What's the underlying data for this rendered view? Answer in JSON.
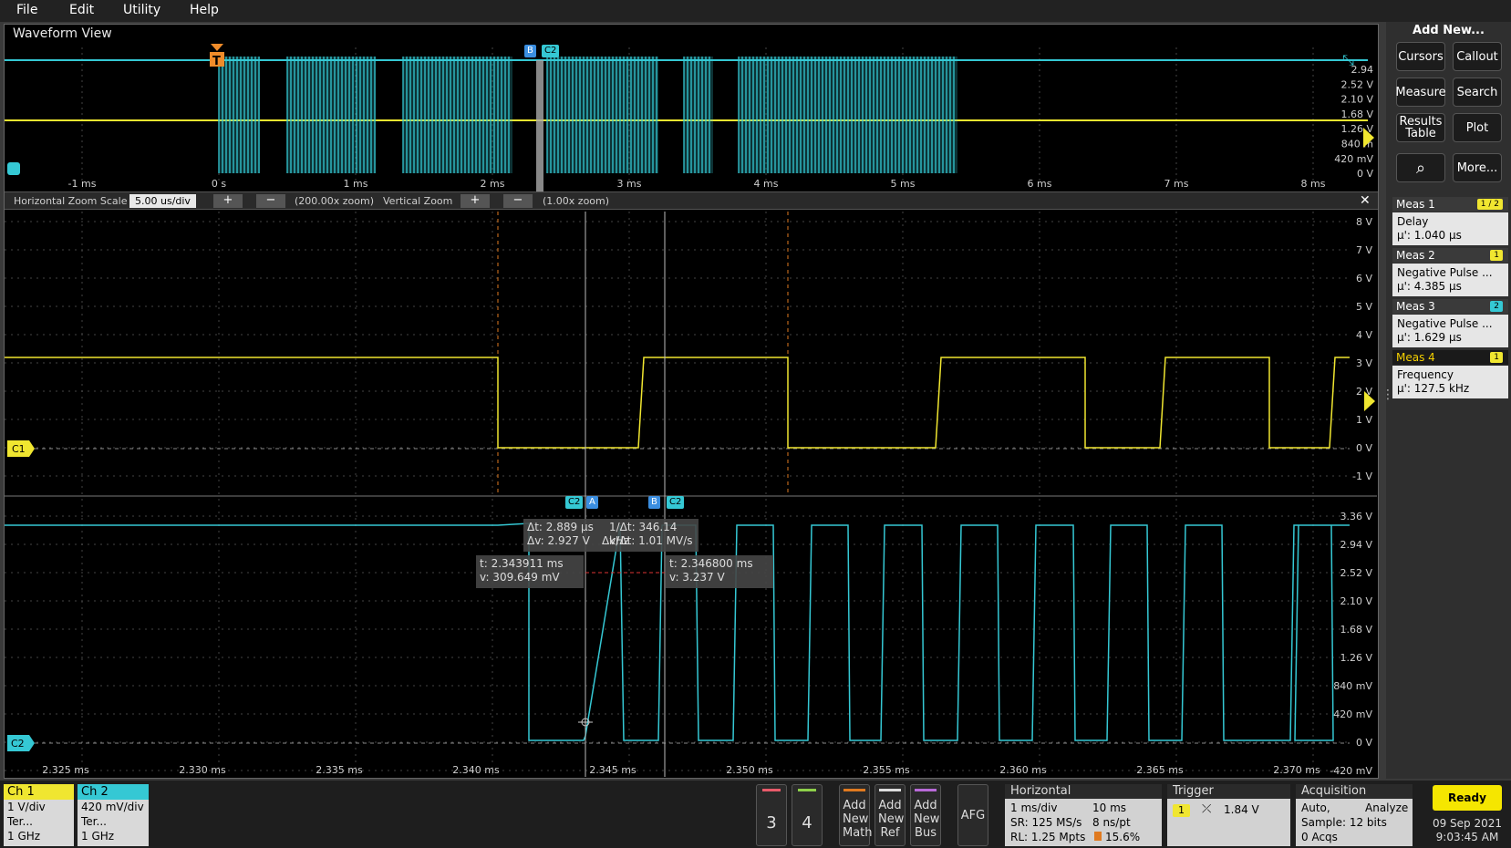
{
  "menu": {
    "file": "File",
    "edit": "Edit",
    "utility": "Utility",
    "help": "Help"
  },
  "waveform_view": {
    "title": "Waveform View"
  },
  "overview": {
    "x_ticks": [
      "-1 ms",
      "0 s",
      "1 ms",
      "2 ms",
      "3 ms",
      "4 ms",
      "5 ms",
      "6 ms",
      "7 ms",
      "8 ms"
    ],
    "y_ticks": [
      "2.94",
      "2.52 V",
      "2.10 V",
      "1.68 V",
      "1.26 V",
      "840 m",
      "420 mV",
      "0 V"
    ],
    "trigger_marker": "T",
    "tag_b": "B",
    "tag_c2": "C2"
  },
  "zoom_bar": {
    "h_label": "Horizontal Zoom Scale",
    "h_value": "5.00 us/div",
    "h_zoom": "(200.00x zoom)",
    "v_label": "Vertical Zoom",
    "v_zoom": "(1.00x zoom)",
    "plus": "+",
    "minus": "−",
    "close": "✕"
  },
  "ch1_plot": {
    "y_ticks": [
      "8 V",
      "7 V",
      "6 V",
      "5 V",
      "4 V",
      "3 V",
      "2 V",
      "1 V",
      "0 V",
      "-1 V"
    ],
    "label": "C1"
  },
  "ch2_plot": {
    "y_ticks": [
      "3.36 V",
      "2.94 V",
      "2.52 V",
      "2.10 V",
      "1.68 V",
      "1.26 V",
      "840 mV",
      "420 mV",
      "0 V",
      "-420 mV"
    ],
    "label": "C2",
    "x_ticks": [
      "2.325 ms",
      "2.330 ms",
      "2.335 ms",
      "2.340 ms",
      "2.345 ms",
      "2.350 ms",
      "2.355 ms",
      "2.360 ms",
      "2.365 ms",
      "2.370 ms"
    ]
  },
  "cursors": {
    "tag_c2_a": "C2",
    "tag_a": "A",
    "tag_b": "B",
    "tag_c2_b": "C2",
    "delta_t": "Δt: 2.889 µs",
    "delta_v": "Δv: 2.927 V",
    "inv_dt": "1/Δt: 346.14 kHz",
    "dv_dt": "Δv/Δt: 1.01 MV/s",
    "a_t": "t: 2.343911 ms",
    "a_v": "v: 309.649 mV",
    "b_t": "t: 2.346800 ms",
    "b_v": "v: 3.237 V"
  },
  "right_panel": {
    "add_new": "Add New...",
    "buttons": {
      "cursors": "Cursors",
      "callout": "Callout",
      "measure": "Measure",
      "search": "Search",
      "results_table": "Results Table",
      "plot": "Plot",
      "more": "More..."
    },
    "meas": [
      {
        "title": "Meas 1",
        "name": "Delay",
        "value": "µ': 1.040 µs",
        "badge": "1 / 2"
      },
      {
        "title": "Meas 2",
        "name": "Negative Pulse ...",
        "value": "µ': 4.385 µs",
        "badge": "1"
      },
      {
        "title": "Meas 3",
        "name": "Negative Pulse ...",
        "value": "µ': 1.629 µs",
        "badge": "2"
      },
      {
        "title": "Meas 4",
        "name": "Frequency",
        "value": "µ': 127.5 kHz",
        "badge": "1"
      }
    ]
  },
  "bottom": {
    "ch1": {
      "title": "Ch 1",
      "scale": "1 V/div",
      "term": "Ter...",
      "bw": "1 GHz"
    },
    "ch2": {
      "title": "Ch 2",
      "scale": "420 mV/div",
      "term": "Ter...",
      "bw": "1 GHz"
    },
    "ch3": "3",
    "ch4": "4",
    "add_math": "Add New Math",
    "add_ref": "Add New Ref",
    "add_bus": "Add New Bus",
    "afg": "AFG",
    "horizontal": {
      "title": "Horizontal",
      "scale": "1 ms/div",
      "duration": "10 ms",
      "sr": "SR: 125 MS/s",
      "pt": "8 ns/pt",
      "rl": "RL: 1.25 Mpts",
      "pos": "15.6%"
    },
    "trigger": {
      "title": "Trigger",
      "source": "1",
      "level": "1.84 V"
    },
    "acquisition": {
      "title": "Acquisition",
      "mode": "Auto,",
      "analyze": "Analyze",
      "sample": "Sample: 12 bits",
      "acqs": "0 Acqs"
    },
    "status": "Ready",
    "date": "09 Sep 2021",
    "time": "9:03:45 AM"
  },
  "colors": {
    "ch1": "#f0e630",
    "ch2": "#35c8d4",
    "bg": "#000000",
    "accent": "#f5c518"
  }
}
